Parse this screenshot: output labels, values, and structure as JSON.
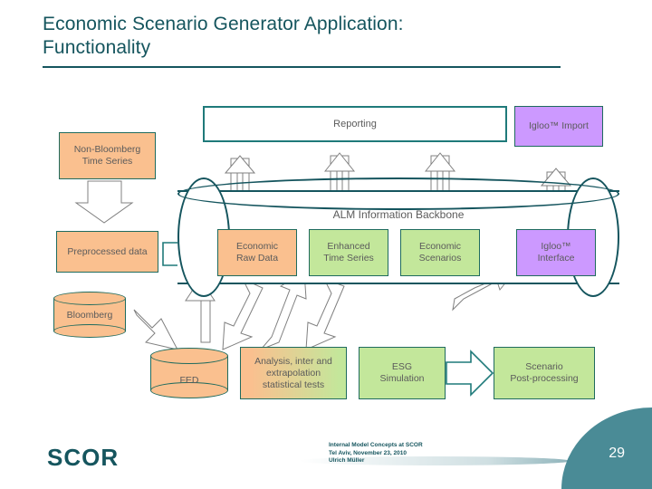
{
  "slide": {
    "title_line1": "Economic Scenario Generator Application:",
    "title_line2": "Functionality",
    "page_number": "29"
  },
  "diagram": {
    "backbone_label": "ALM Information Backbone",
    "reporting_box": "Reporting",
    "igloo_import_box": "Igloo™ Import",
    "top_left_box": "Non-Bloomberg\nTime Series",
    "top_left_box_line1": "Non-Bloomberg",
    "top_left_box_line2": "Time Series",
    "preprocessed_box": "Preprocessed data",
    "backbone_items": [
      {
        "label_line1": "Economic",
        "label_line2": "Raw Data",
        "color": "#fac08f",
        "kind": "peach"
      },
      {
        "label_line1": "Enhanced",
        "label_line2": "Time Series",
        "color": "#c3e79b",
        "kind": "green"
      },
      {
        "label_line1": "Economic",
        "label_line2": "Scenarios",
        "color": "#c3e79b",
        "kind": "green"
      },
      {
        "label_line1": "Igloo™",
        "label_line2": "Interface",
        "color": "#cc99ff",
        "kind": "purple"
      }
    ],
    "databases": [
      {
        "label": "Bloomberg"
      },
      {
        "label": "FED"
      }
    ],
    "process_boxes": [
      {
        "label_line1": "Analysis, inter and",
        "label_line2": "extrapolation",
        "label_line3": "statistical tests",
        "kind": "gradient"
      },
      {
        "label_line1": "ESG",
        "label_line2": "Simulation",
        "label_line3": "",
        "kind": "green"
      },
      {
        "label_line1": "Scenario",
        "label_line2": "Post-processing",
        "label_line3": "",
        "kind": "green"
      }
    ]
  },
  "footer": {
    "logo": "SCOR",
    "line1": "Internal Model Concepts at SCOR",
    "line2": "Tel Aviv, November 23, 2010",
    "line3": "Ulrich Müller"
  },
  "colors": {
    "teal": "#15555e",
    "teal_accent": "#1f7a7a",
    "peach": "#fac08f",
    "green": "#c3e79b",
    "purple": "#cc99ff",
    "wedge": "#4a8b96",
    "box_border": "#1f6b5e",
    "text_gray": "#5b5b5b"
  }
}
